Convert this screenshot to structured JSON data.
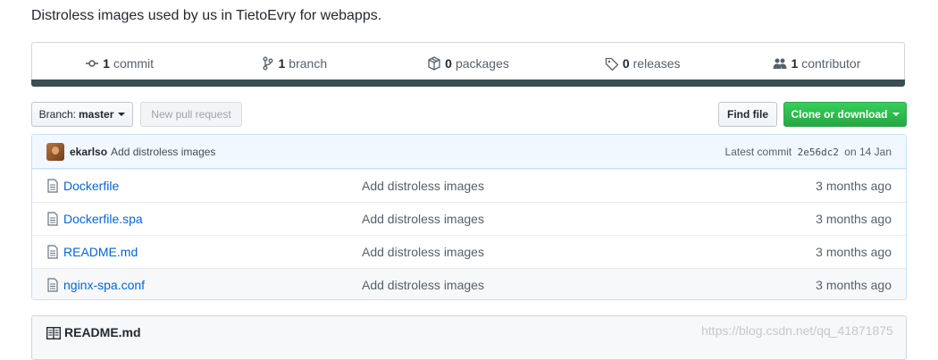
{
  "description": "Distroless images used by us in TietoEvry for webapps.",
  "summary": {
    "commits": {
      "count": "1",
      "label": "commit"
    },
    "branches": {
      "count": "1",
      "label": "branch"
    },
    "packages": {
      "count": "0",
      "label": "packages"
    },
    "releases": {
      "count": "0",
      "label": "releases"
    },
    "contributors": {
      "count": "1",
      "label": "contributor"
    }
  },
  "language_bar_color": "#384d54",
  "toolbar": {
    "branch_prefix": "Branch:",
    "branch_name": "master",
    "new_pr": "New pull request",
    "find_file": "Find file",
    "clone": "Clone or download"
  },
  "latest_commit": {
    "author": "ekarlso",
    "message": "Add distroless images",
    "prefix": "Latest commit",
    "sha": "2e56dc2",
    "date": "on 14 Jan"
  },
  "files": [
    {
      "name": "Dockerfile",
      "message": "Add distroless images",
      "age": "3 months ago"
    },
    {
      "name": "Dockerfile.spa",
      "message": "Add distroless images",
      "age": "3 months ago"
    },
    {
      "name": "README.md",
      "message": "Add distroless images",
      "age": "3 months ago"
    },
    {
      "name": "nginx-spa.conf",
      "message": "Add distroless images",
      "age": "3 months ago"
    }
  ],
  "readme_title": "README.md",
  "watermark": "https://blog.csdn.net/qq_41871875",
  "colors": {
    "link": "#0366d6",
    "clone_button": "#28a745",
    "commit_bar": "#f1f8ff"
  }
}
